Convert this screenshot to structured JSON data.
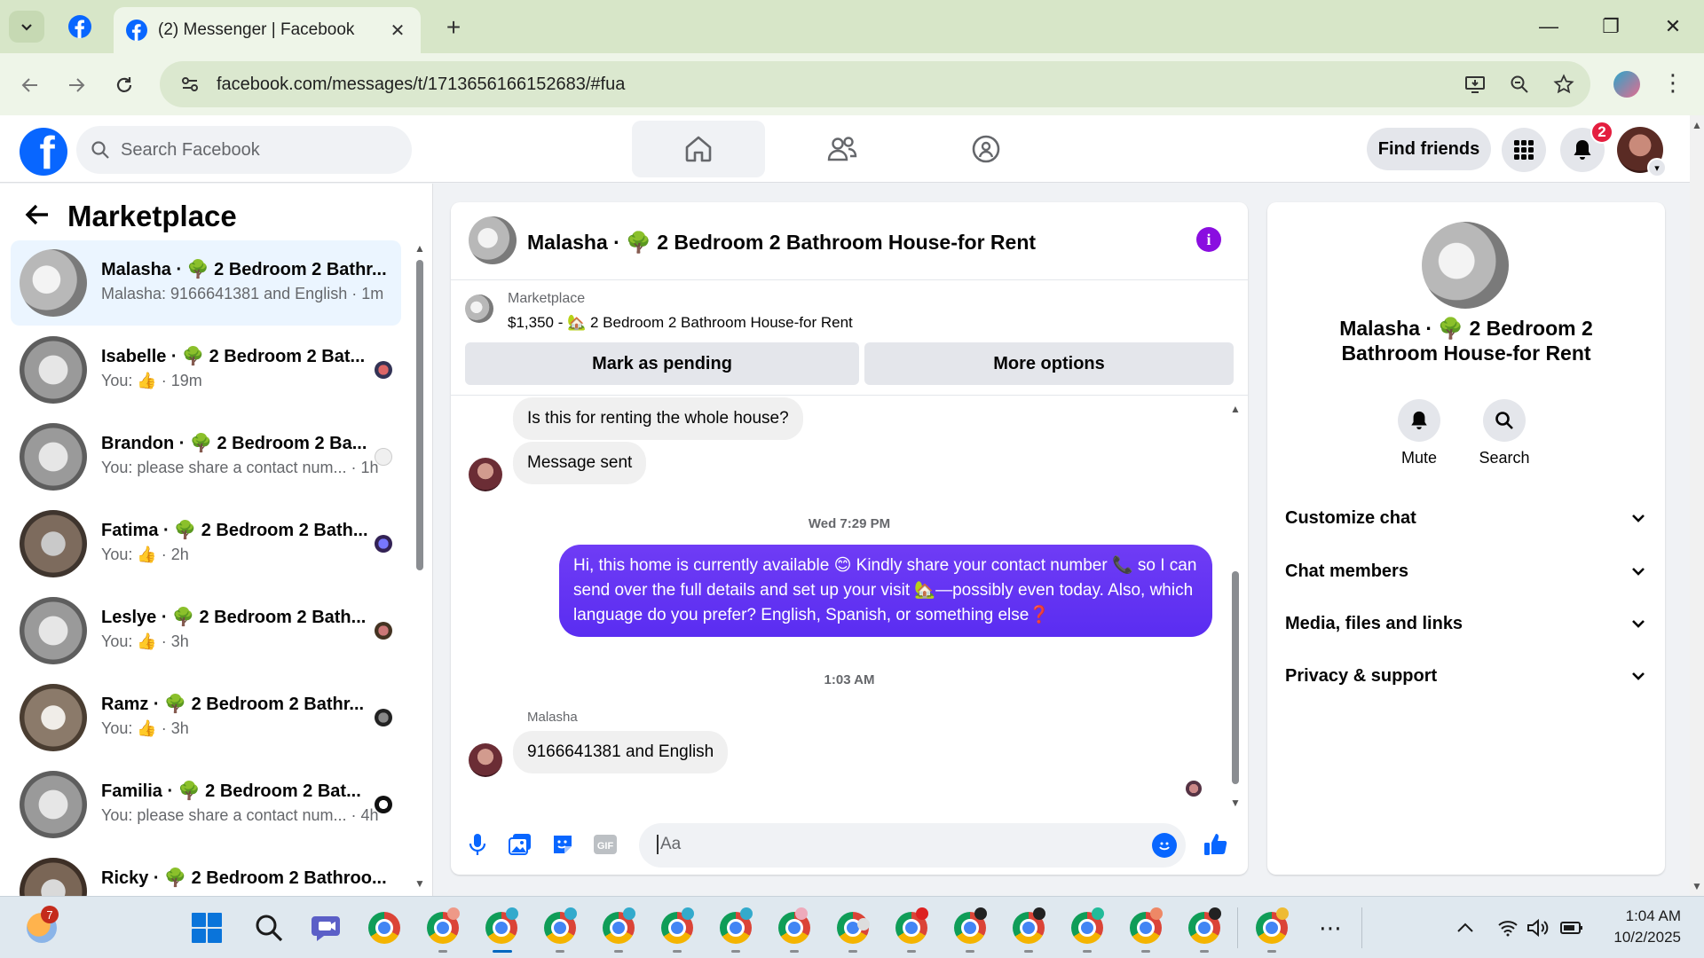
{
  "browser": {
    "tab_title": "(2) Messenger | Facebook",
    "url": "facebook.com/messages/t/1713656166152683/#fua"
  },
  "header": {
    "search_placeholder": "Search Facebook",
    "find_friends": "Find friends",
    "notification_count": "2"
  },
  "left": {
    "title": "Marketplace",
    "conversations": [
      {
        "name": "Malasha · 🌳 2 Bedroom 2 Bathr...",
        "preview": "Malasha: 9166641381 and English · 1m",
        "active": true
      },
      {
        "name": "Isabelle · 🌳 2 Bedroom 2 Bat...",
        "preview": "You: 👍 · 19m"
      },
      {
        "name": "Brandon · 🌳 2 Bedroom 2 Ba...",
        "preview": "You: please share a contact num... · 1h"
      },
      {
        "name": "Fatima · 🌳 2 Bedroom 2 Bath...",
        "preview": "You: 👍 · 2h"
      },
      {
        "name": "Leslye · 🌳 2 Bedroom 2 Bath...",
        "preview": "You: 👍 · 3h"
      },
      {
        "name": "Ramz · 🌳 2 Bedroom 2 Bathr...",
        "preview": "You: 👍 · 3h"
      },
      {
        "name": "Familia · 🌳 2 Bedroom 2 Bat...",
        "preview": "You: please share a contact num... · 4h"
      },
      {
        "name": "Ricky · 🌳 2 Bedroom 2 Bathroo...",
        "preview": ""
      }
    ]
  },
  "chat": {
    "title": "Malasha · 🌳 2 Bedroom 2 Bathroom House-for Rent",
    "listing_label": "Marketplace",
    "listing_price": "$1,350 - 🏡 2 Bedroom 2 Bathroom House-for Rent",
    "mark_pending": "Mark as pending",
    "more_options": "More options",
    "msg_question": "Is this for renting the whole house?",
    "msg_sent": "Message sent",
    "ts_1": "Wed 7:29 PM",
    "msg_out": "Hi, this home is currently available 😊 Kindly share your contact number 📞 so I can send over the full details and set up your visit 🏡—possibly even today. Also, which language do you prefer? English, Spanish, or something else❓",
    "ts_2": "1:03 AM",
    "sender": "Malasha",
    "msg_reply": "9166641381 and English",
    "input_placeholder": "Aa"
  },
  "right": {
    "title": "Malasha · 🌳 2 Bedroom 2 Bathroom House-for Rent",
    "mute": "Mute",
    "search": "Search",
    "rows": [
      "Customize chat",
      "Chat members",
      "Media, files and links",
      "Privacy & support"
    ]
  },
  "taskbar": {
    "weather_badge": "7",
    "time": "1:04 AM",
    "date": "10/2/2025"
  },
  "colors": {
    "fb_blue": "#0866ff",
    "outgoing_bubble": "#5a2df1",
    "tab_green": "#d7e6c8"
  }
}
